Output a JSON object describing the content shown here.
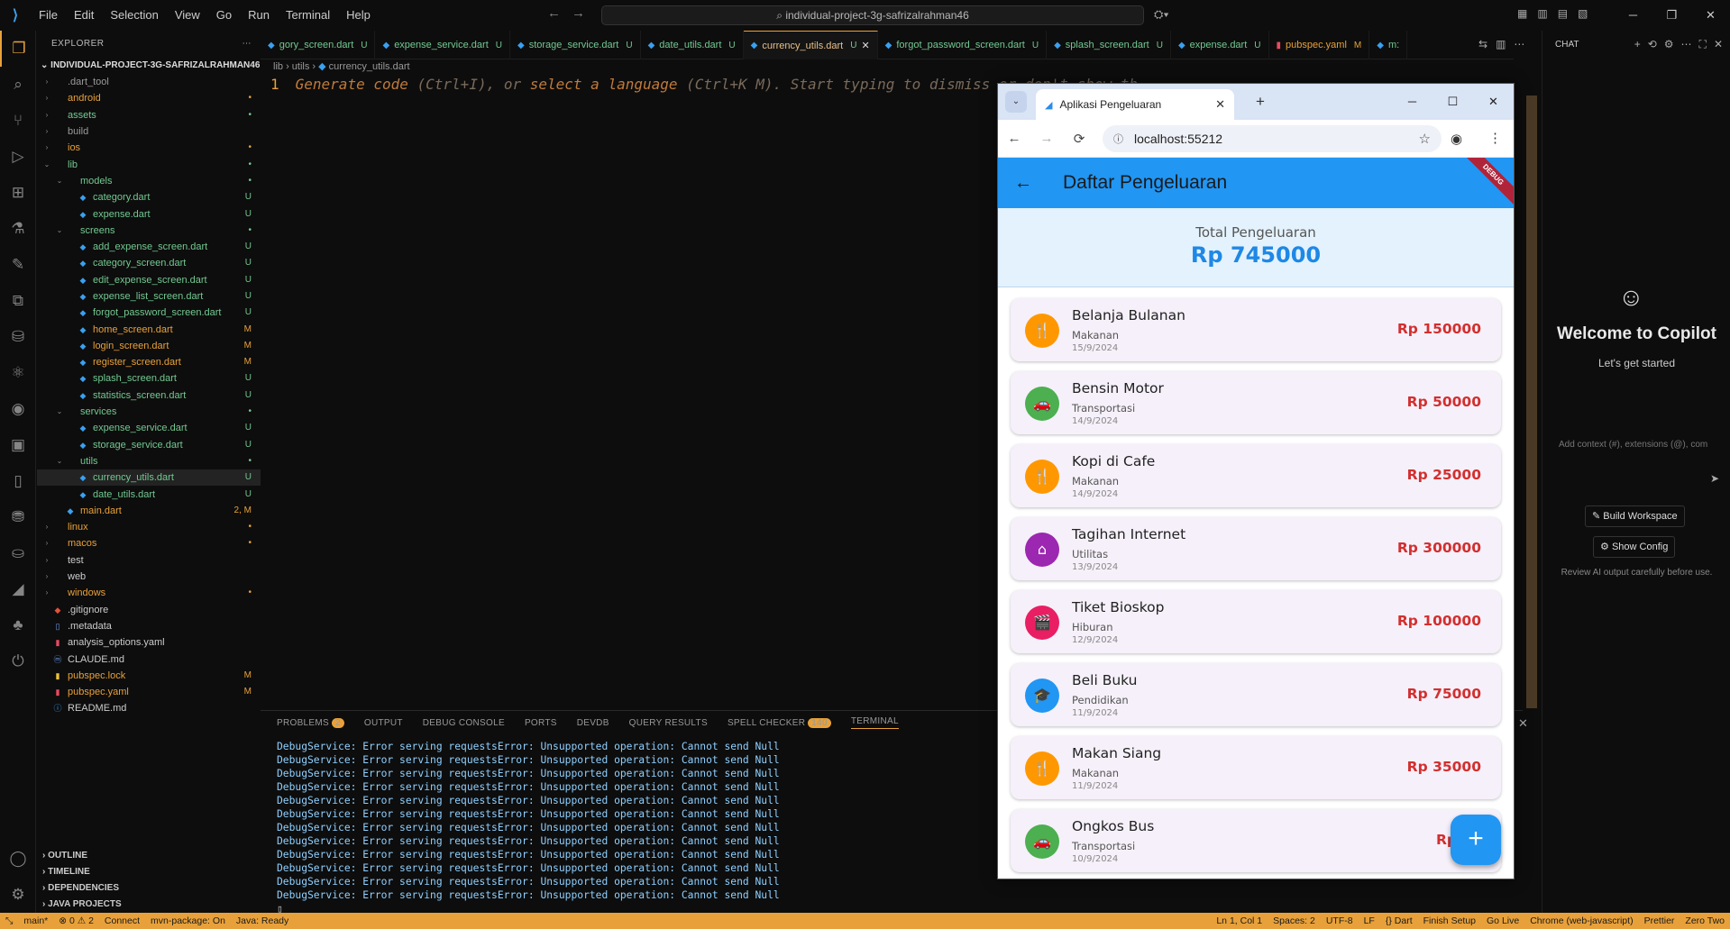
{
  "menu": [
    "File",
    "Edit",
    "Selection",
    "View",
    "Go",
    "Run",
    "Terminal",
    "Help"
  ],
  "search": "individual-project-3g-safrizalrahman46",
  "explorer": {
    "title": "EXPLORER",
    "root": "INDIVIDUAL-PROJECT-3G-SAFRIZALRAHMAN46",
    "items": [
      {
        "name": ".dart_tool",
        "depth": 0,
        "kind": "folder",
        "status": "",
        "color": "#9a9a9a"
      },
      {
        "name": "android",
        "depth": 0,
        "kind": "folder",
        "status": "•",
        "color": "#e8a13a"
      },
      {
        "name": "assets",
        "depth": 0,
        "kind": "folder",
        "status": "•",
        "color": "#73c991"
      },
      {
        "name": "build",
        "depth": 0,
        "kind": "folder",
        "status": "",
        "color": "#9a9a9a"
      },
      {
        "name": "ios",
        "depth": 0,
        "kind": "folder",
        "status": "•",
        "color": "#e8a13a"
      },
      {
        "name": "lib",
        "depth": 0,
        "kind": "folder-open",
        "status": "•",
        "color": "#73c991"
      },
      {
        "name": "models",
        "depth": 1,
        "kind": "folder-open",
        "status": "•",
        "color": "#73c991"
      },
      {
        "name": "category.dart",
        "depth": 2,
        "kind": "dart",
        "status": "U",
        "color": "#73c991"
      },
      {
        "name": "expense.dart",
        "depth": 2,
        "kind": "dart",
        "status": "U",
        "color": "#73c991"
      },
      {
        "name": "screens",
        "depth": 1,
        "kind": "folder-open",
        "status": "•",
        "color": "#73c991"
      },
      {
        "name": "add_expense_screen.dart",
        "depth": 2,
        "kind": "dart",
        "status": "U",
        "color": "#73c991"
      },
      {
        "name": "category_screen.dart",
        "depth": 2,
        "kind": "dart",
        "status": "U",
        "color": "#73c991"
      },
      {
        "name": "edit_expense_screen.dart",
        "depth": 2,
        "kind": "dart",
        "status": "U",
        "color": "#73c991"
      },
      {
        "name": "expense_list_screen.dart",
        "depth": 2,
        "kind": "dart",
        "status": "U",
        "color": "#73c991"
      },
      {
        "name": "forgot_password_screen.dart",
        "depth": 2,
        "kind": "dart",
        "status": "U",
        "color": "#73c991"
      },
      {
        "name": "home_screen.dart",
        "depth": 2,
        "kind": "dart",
        "status": "M",
        "color": "#e8a13a"
      },
      {
        "name": "login_screen.dart",
        "depth": 2,
        "kind": "dart",
        "status": "M",
        "color": "#e8a13a"
      },
      {
        "name": "register_screen.dart",
        "depth": 2,
        "kind": "dart",
        "status": "M",
        "color": "#e8a13a"
      },
      {
        "name": "splash_screen.dart",
        "depth": 2,
        "kind": "dart",
        "status": "U",
        "color": "#73c991"
      },
      {
        "name": "statistics_screen.dart",
        "depth": 2,
        "kind": "dart",
        "status": "U",
        "color": "#73c991"
      },
      {
        "name": "services",
        "depth": 1,
        "kind": "folder-open",
        "status": "•",
        "color": "#73c991"
      },
      {
        "name": "expense_service.dart",
        "depth": 2,
        "kind": "dart",
        "status": "U",
        "color": "#73c991"
      },
      {
        "name": "storage_service.dart",
        "depth": 2,
        "kind": "dart",
        "status": "U",
        "color": "#73c991"
      },
      {
        "name": "utils",
        "depth": 1,
        "kind": "folder-open",
        "status": "•",
        "color": "#73c991"
      },
      {
        "name": "currency_utils.dart",
        "depth": 2,
        "kind": "dart",
        "status": "U",
        "color": "#73c991",
        "selected": true
      },
      {
        "name": "date_utils.dart",
        "depth": 2,
        "kind": "dart",
        "status": "U",
        "color": "#73c991"
      },
      {
        "name": "main.dart",
        "depth": 1,
        "kind": "dart",
        "status": "2, M",
        "color": "#e8a13a"
      },
      {
        "name": "linux",
        "depth": 0,
        "kind": "folder",
        "status": "•",
        "color": "#e8a13a"
      },
      {
        "name": "macos",
        "depth": 0,
        "kind": "folder",
        "status": "•",
        "color": "#e8a13a"
      },
      {
        "name": "test",
        "depth": 0,
        "kind": "folder",
        "status": "",
        "color": "#cccccc"
      },
      {
        "name": "web",
        "depth": 0,
        "kind": "folder",
        "status": "",
        "color": "#cccccc"
      },
      {
        "name": "windows",
        "depth": 0,
        "kind": "folder",
        "status": "•",
        "color": "#e8a13a"
      },
      {
        "name": ".gitignore",
        "depth": 0,
        "kind": "git",
        "status": "",
        "color": "#cccccc"
      },
      {
        "name": ".metadata",
        "depth": 0,
        "kind": "file",
        "status": "",
        "color": "#cccccc"
      },
      {
        "name": "analysis_options.yaml",
        "depth": 0,
        "kind": "yaml",
        "status": "",
        "color": "#cccccc"
      },
      {
        "name": "CLAUDE.md",
        "depth": 0,
        "kind": "md",
        "status": "",
        "color": "#cccccc"
      },
      {
        "name": "pubspec.lock",
        "depth": 0,
        "kind": "lock",
        "status": "M",
        "color": "#e8a13a"
      },
      {
        "name": "pubspec.yaml",
        "depth": 0,
        "kind": "yaml",
        "status": "M",
        "color": "#e8a13a"
      },
      {
        "name": "README.md",
        "depth": 0,
        "kind": "info",
        "status": "",
        "color": "#cccccc"
      }
    ],
    "sections": [
      "OUTLINE",
      "TIMELINE",
      "DEPENDENCIES",
      "JAVA PROJECTS"
    ]
  },
  "tabs": [
    {
      "label": "gory_screen.dart",
      "status": "U",
      "icon": "dart",
      "color": "#73c991"
    },
    {
      "label": "expense_service.dart",
      "status": "U",
      "icon": "dart",
      "color": "#73c991"
    },
    {
      "label": "storage_service.dart",
      "status": "U",
      "icon": "dart",
      "color": "#73c991"
    },
    {
      "label": "date_utils.dart",
      "status": "U",
      "icon": "dart",
      "color": "#73c991"
    },
    {
      "label": "currency_utils.dart",
      "status": "U",
      "icon": "dart",
      "color": "#73c991",
      "active": true
    },
    {
      "label": "forgot_password_screen.dart",
      "status": "U",
      "icon": "dart",
      "color": "#73c991"
    },
    {
      "label": "splash_screen.dart",
      "status": "U",
      "icon": "dart",
      "color": "#73c991"
    },
    {
      "label": "expense.dart",
      "status": "U",
      "icon": "dart",
      "color": "#73c991"
    },
    {
      "label": "pubspec.yaml",
      "status": "M",
      "icon": "yaml",
      "color": "#e8a13a"
    },
    {
      "label": "m:",
      "status": "",
      "icon": "dart",
      "color": "#73c991"
    }
  ],
  "breadcrumb": [
    "lib",
    "utils",
    "currency_utils.dart"
  ],
  "editor": {
    "line_number": "1",
    "hint_prefix": "Generate code",
    "hint_key1": "(Ctrl+I), or",
    "hint_mid": "select a language",
    "hint_key2": "(Ctrl+K M). Start typing to dismiss or don't show th"
  },
  "panel": {
    "tabs": [
      {
        "label": "PROBLEMS",
        "badge": "2"
      },
      {
        "label": "OUTPUT",
        "badge": ""
      },
      {
        "label": "DEBUG CONSOLE",
        "badge": ""
      },
      {
        "label": "PORTS",
        "badge": ""
      },
      {
        "label": "DEVDB",
        "badge": ""
      },
      {
        "label": "QUERY RESULTS",
        "badge": ""
      },
      {
        "label": "SPELL CHECKER",
        "badge": "140"
      },
      {
        "label": "TERMINAL",
        "badge": "",
        "active": true
      }
    ],
    "terminal_line": "DebugService: Error serving requestsError: Unsupported operation: Cannot send Null",
    "terminal_count": 12
  },
  "chat": {
    "title": "CHAT",
    "welcome": "Welcome to Copilot",
    "sub": "Let's get started",
    "placeholder": "Add context (#), extensions (@), com",
    "build_btn": "Build Workspace",
    "config_btn": "Show Config",
    "note": "Review AI output carefully before use."
  },
  "statusbar": {
    "left": [
      "main*",
      "⊗ 0 ⚠ 2",
      "Connect",
      "mvn-package: On",
      "Java: Ready"
    ],
    "right": [
      "Ln 1, Col 1",
      "Spaces: 2",
      "UTF-8",
      "LF",
      "{} Dart",
      "Finish Setup",
      "Go Live",
      "Chrome (web-javascript)",
      "Prettier",
      "Zero Two"
    ]
  },
  "browser": {
    "tab_title": "Aplikasi Pengeluaran",
    "url": "localhost:55212",
    "app_title": "Daftar Pengeluaran",
    "debug_label": "DEBUG",
    "total_label": "Total Pengeluaran",
    "total_value": "Rp 745000",
    "expenses": [
      {
        "title": "Belanja Bulanan",
        "category": "Makanan",
        "date": "15/9/2024",
        "amount": "Rp 150000",
        "icon": "utensils-icon",
        "glyph": "🍴",
        "color": "#ff9800"
      },
      {
        "title": "Bensin Motor",
        "category": "Transportasi",
        "date": "14/9/2024",
        "amount": "Rp 50000",
        "icon": "car-icon",
        "glyph": "🚗",
        "color": "#4caf50"
      },
      {
        "title": "Kopi di Cafe",
        "category": "Makanan",
        "date": "14/9/2024",
        "amount": "Rp 25000",
        "icon": "utensils-icon",
        "glyph": "🍴",
        "color": "#ff9800"
      },
      {
        "title": "Tagihan Internet",
        "category": "Utilitas",
        "date": "13/9/2024",
        "amount": "Rp 300000",
        "icon": "home-icon",
        "glyph": "⌂",
        "color": "#9c27b0"
      },
      {
        "title": "Tiket Bioskop",
        "category": "Hiburan",
        "date": "12/9/2024",
        "amount": "Rp 100000",
        "icon": "movie-icon",
        "glyph": "🎬",
        "color": "#e91e63"
      },
      {
        "title": "Beli Buku",
        "category": "Pendidikan",
        "date": "11/9/2024",
        "amount": "Rp 75000",
        "icon": "school-icon",
        "glyph": "🎓",
        "color": "#2196f3"
      },
      {
        "title": "Makan Siang",
        "category": "Makanan",
        "date": "11/9/2024",
        "amount": "Rp 35000",
        "icon": "utensils-icon",
        "glyph": "🍴",
        "color": "#ff9800"
      },
      {
        "title": "Ongkos Bus",
        "category": "Transportasi",
        "date": "10/9/2024",
        "amount": "Rp 10",
        "icon": "car-icon",
        "glyph": "🚗",
        "color": "#4caf50"
      }
    ]
  }
}
